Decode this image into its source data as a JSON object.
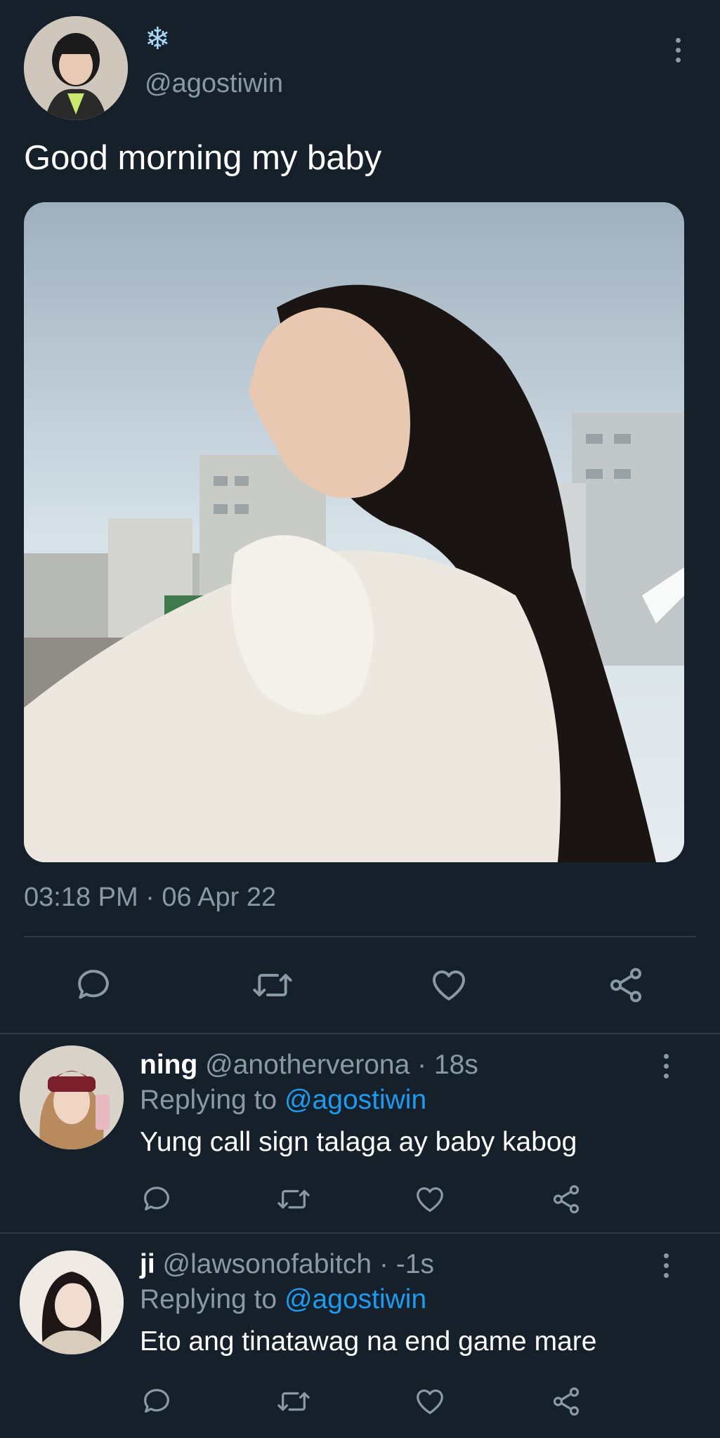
{
  "tweet": {
    "display_name": "❄",
    "handle": "@agostiwin",
    "text": "Good morning my baby",
    "time": "03:18 PM · 06 Apr 22"
  },
  "replies": [
    {
      "name": "ning",
      "handle": "@anotherverona",
      "time": "· 18s",
      "replying_label": "Replying to",
      "replying_to": "@agostiwin",
      "text": "Yung call sign talaga ay baby kabog"
    },
    {
      "name": "ji",
      "handle": "@lawsonofabitch",
      "time": "· -1s",
      "replying_label": "Replying to",
      "replying_to": "@agostiwin",
      "text": "Eto ang tinatawag na end game mare"
    }
  ],
  "icons": {
    "reply": "reply-icon",
    "retweet": "retweet-icon",
    "like": "like-icon",
    "share": "share-icon",
    "more": "more-options-icon"
  },
  "colors": {
    "background": "#15202b",
    "link": "#1d9bf0",
    "muted": "#8b98a5"
  }
}
